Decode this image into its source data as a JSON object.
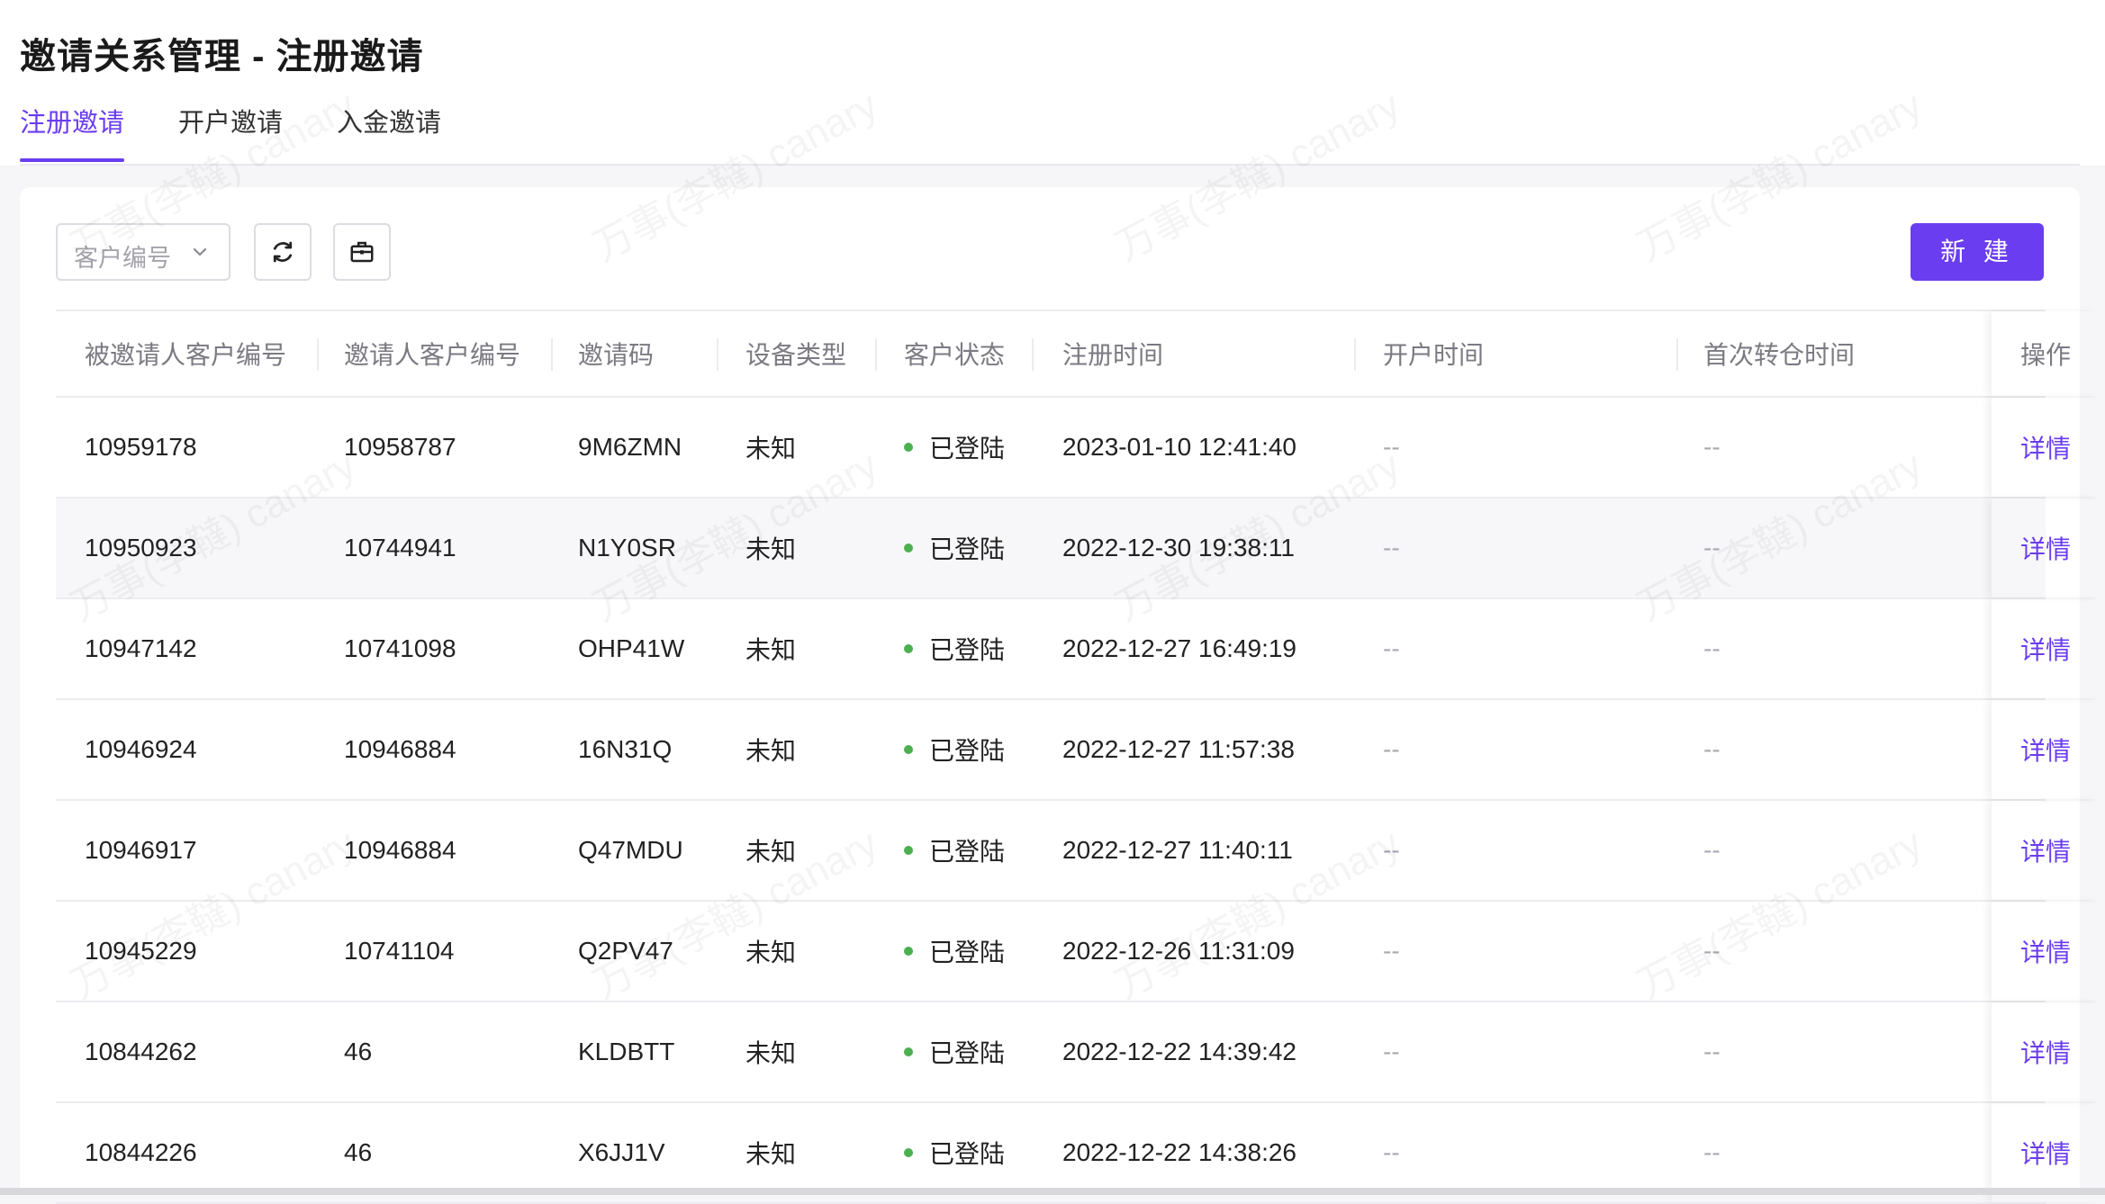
{
  "page": {
    "title": "邀请关系管理 - 注册邀请"
  },
  "tabs": [
    {
      "label": "注册邀请",
      "active": true
    },
    {
      "label": "开户邀请",
      "active": false
    },
    {
      "label": "入金邀请",
      "active": false
    }
  ],
  "toolbar": {
    "select_placeholder": "客户编号",
    "refresh_icon": "refresh-icon",
    "export_icon": "toolbox-icon",
    "new_label": "新 建"
  },
  "table": {
    "headers": [
      "被邀请人客户编号",
      "邀请人客户编号",
      "邀请码",
      "设备类型",
      "客户状态",
      "注册时间",
      "开户时间",
      "首次转仓时间",
      "操作"
    ],
    "rows": [
      {
        "invitee": "10959178",
        "inviter": "10958787",
        "code": "9M6ZMN",
        "device": "未知",
        "status": "已登陆",
        "register_time": "2023-01-10 12:41:40",
        "open_time": "--",
        "first_transfer": "--",
        "action": "详情"
      },
      {
        "invitee": "10950923",
        "inviter": "10744941",
        "code": "N1Y0SR",
        "device": "未知",
        "status": "已登陆",
        "register_time": "2022-12-30 19:38:11",
        "open_time": "--",
        "first_transfer": "--",
        "action": "详情"
      },
      {
        "invitee": "10947142",
        "inviter": "10741098",
        "code": "OHP41W",
        "device": "未知",
        "status": "已登陆",
        "register_time": "2022-12-27 16:49:19",
        "open_time": "--",
        "first_transfer": "--",
        "action": "详情"
      },
      {
        "invitee": "10946924",
        "inviter": "10946884",
        "code": "16N31Q",
        "device": "未知",
        "status": "已登陆",
        "register_time": "2022-12-27 11:57:38",
        "open_time": "--",
        "first_transfer": "--",
        "action": "详情"
      },
      {
        "invitee": "10946917",
        "inviter": "10946884",
        "code": "Q47MDU",
        "device": "未知",
        "status": "已登陆",
        "register_time": "2022-12-27 11:40:11",
        "open_time": "--",
        "first_transfer": "--",
        "action": "详情"
      },
      {
        "invitee": "10945229",
        "inviter": "10741104",
        "code": "Q2PV47",
        "device": "未知",
        "status": "已登陆",
        "register_time": "2022-12-26 11:31:09",
        "open_time": "--",
        "first_transfer": "--",
        "action": "详情"
      },
      {
        "invitee": "10844262",
        "inviter": "46",
        "code": "KLDBTT",
        "device": "未知",
        "status": "已登陆",
        "register_time": "2022-12-22 14:39:42",
        "open_time": "--",
        "first_transfer": "--",
        "action": "详情"
      },
      {
        "invitee": "10844226",
        "inviter": "46",
        "code": "X6JJ1V",
        "device": "未知",
        "status": "已登陆",
        "register_time": "2022-12-22 14:38:26",
        "open_time": "--",
        "first_transfer": "--",
        "action": "详情"
      }
    ]
  },
  "watermark": "万事(李韃) canary",
  "colors": {
    "accent": "#6a3df0",
    "status_dot": "#4caf50"
  }
}
